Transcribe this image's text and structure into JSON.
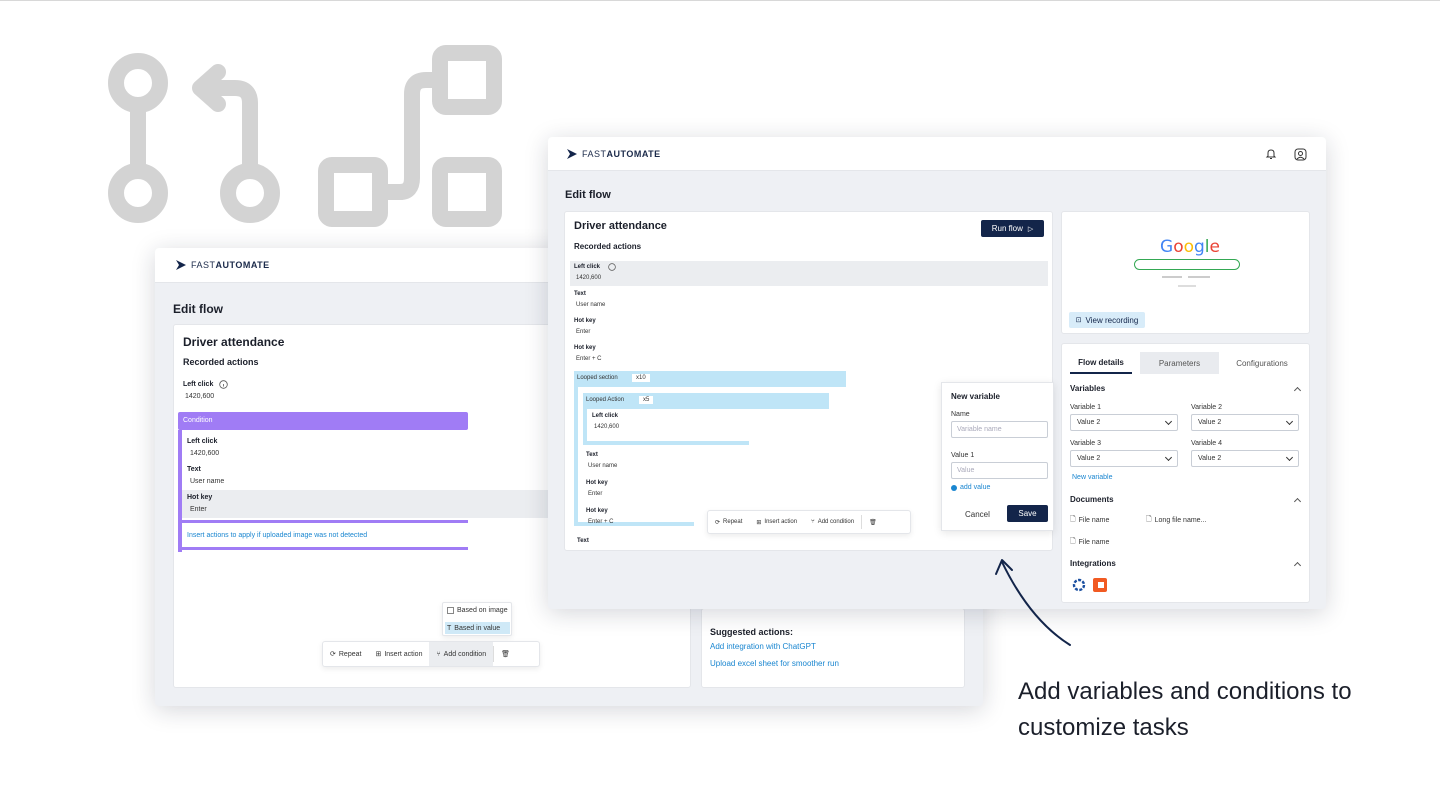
{
  "caption": {
    "line1": "Add variables and conditions to",
    "line2": "customize tasks"
  },
  "brand": {
    "name_light": "FAST",
    "name_bold": "AUTOMATE"
  },
  "back_window": {
    "page_title": "Edit flow",
    "flow_title": "Driver attendance",
    "section_title": "Recorded actions",
    "left_click": {
      "label": "Left click",
      "value": "1420,600"
    },
    "condition": {
      "label": "Condition",
      "left_click": {
        "label": "Left click",
        "value": "1420,600"
      },
      "text": {
        "label": "Text",
        "value": "User name"
      },
      "hotkey": {
        "label": "Hot key",
        "value": "Enter"
      },
      "insert_hint": "Insert actions to apply if uploaded image was not detected"
    },
    "cond_menu": {
      "based_image": "Based on image",
      "based_value": "Based in value"
    },
    "toolbar": {
      "repeat": "Repeat",
      "insert": "Insert action",
      "add_condition": "Add condition"
    },
    "suggested": {
      "title": "Suggested actions:",
      "items": [
        "Add integration with ChatGPT",
        "Upload excel sheet for smoother run"
      ]
    }
  },
  "front_window": {
    "page_title": "Edit flow",
    "flow_title": "Driver attendance",
    "run_button": "Run flow",
    "section_title": "Recorded actions",
    "actions": {
      "left_click": {
        "label": "Left click",
        "value": "1420,600"
      },
      "text": {
        "label": "Text",
        "value": "User name"
      },
      "hotkey1": {
        "label": "Hot key",
        "value": "Enter"
      },
      "hotkey2": {
        "label": "Hot key",
        "value": "Enter  +  C"
      },
      "looped_section": {
        "label": "Looped section",
        "count": "x10"
      },
      "looped_action": {
        "label": "Looped Action",
        "count": "x5"
      },
      "inner_left_click": {
        "label": "Left click",
        "value": "1420,600"
      },
      "inner_text": {
        "label": "Text",
        "value": "User name"
      },
      "inner_hotkey1": {
        "label": "Hot key",
        "value": "Enter"
      },
      "inner_hotkey2": {
        "label": "Hot key",
        "value": "Enter  +  C"
      },
      "last": {
        "label": "Text"
      }
    },
    "toolbar": {
      "repeat": "Repeat",
      "insert": "Insert action",
      "add_condition": "Add condition"
    },
    "new_variable": {
      "title": "New variable",
      "name_label": "Name",
      "name_placeholder": "Variable name",
      "value_label": "Value 1",
      "value_placeholder": "Value",
      "add_value": "add value",
      "cancel": "Cancel",
      "save": "Save"
    },
    "preview": {
      "google": "Google",
      "view_recording": "View recording"
    },
    "tabs": [
      "Flow details",
      "Parameters",
      "Configurations"
    ],
    "variables": {
      "title": "Variables",
      "items": [
        {
          "label": "Variable 1",
          "value": "Value 2"
        },
        {
          "label": "Variable 2",
          "value": "Value 2"
        },
        {
          "label": "Variable 3",
          "value": "Value 2"
        },
        {
          "label": "Variable 4",
          "value": "Value 2"
        }
      ],
      "new_link": "New variable"
    },
    "documents": {
      "title": "Documents",
      "items": [
        "File name",
        "Long file name...",
        "File name"
      ]
    },
    "integrations": {
      "title": "Integrations"
    }
  },
  "colors": {
    "navy": "#13254a",
    "purple": "#a07cf5",
    "light_blue": "#bfe5f7",
    "link": "#1a86d0",
    "deco_gray": "#d3d3d3"
  }
}
